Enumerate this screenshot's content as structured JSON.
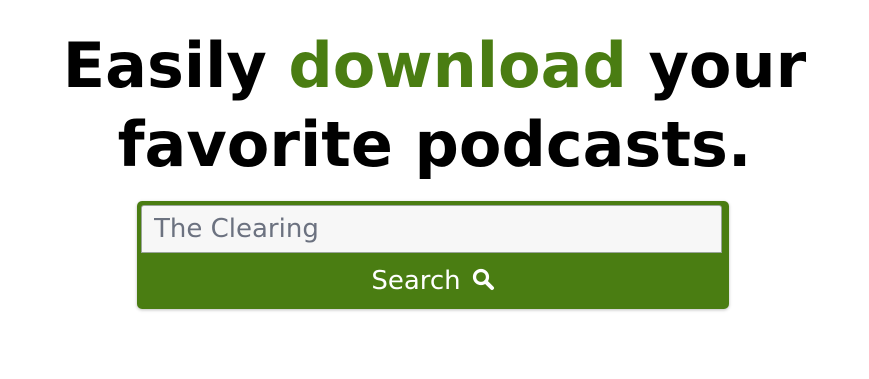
{
  "hero": {
    "headline_part1": "Easily ",
    "headline_accent": "download",
    "headline_part2": " your favorite podcasts.",
    "accent_color": "#4a7d12"
  },
  "search": {
    "input_value": "The Clearing",
    "placeholder": "The Clearing",
    "button_label": "Search",
    "button_icon": "search-icon",
    "button_color": "#4a7d12"
  }
}
